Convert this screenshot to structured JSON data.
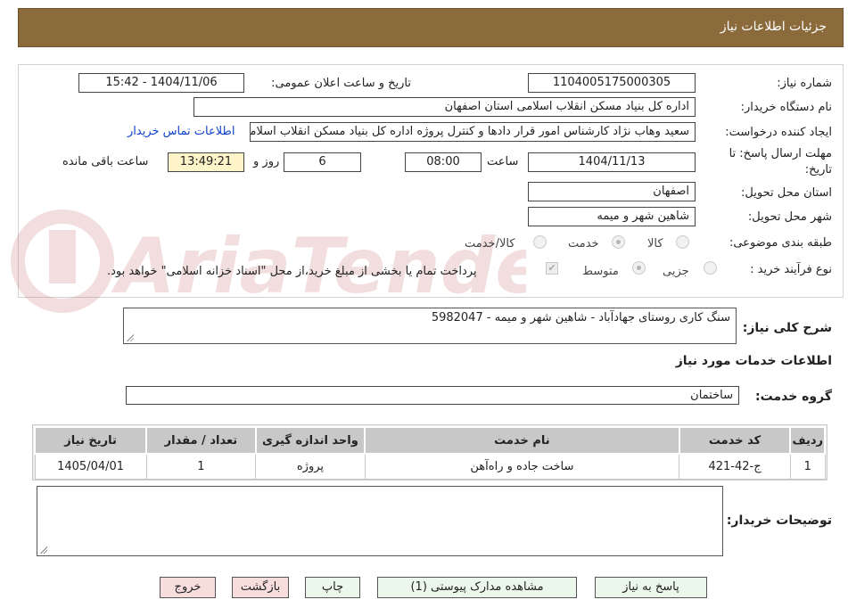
{
  "header": {
    "title": "جزئیات اطلاعات نیاز"
  },
  "form": {
    "need_number_label": "شماره نیاز:",
    "need_number": "1104005175000305",
    "announce_label": "تاریخ و ساعت اعلان عمومی:",
    "announce_value": "1404/11/06 - 15:42",
    "buyer_org_label": "نام دستگاه خریدار:",
    "buyer_org": "اداره کل بنیاد مسکن انقلاب اسلامی استان اصفهان",
    "creator_label": "ایجاد کننده درخواست:",
    "creator": "سعید وهاب نژاد کارشناس امور قرار دادها و کنترل  پروژه اداره کل بنیاد مسکن انقلاب اسلامی استان اصفهان",
    "contact_link": "اطلاعات تماس خریدار",
    "deadline_label_1": "مهلت ارسال پاسخ: تا",
    "deadline_label_2": "تاریخ:",
    "deadline_date": "1404/11/13",
    "time_label": "ساعت",
    "deadline_time": "08:00",
    "days_value": "6",
    "days_label": "روز و",
    "remaining_time": "13:49:21",
    "remaining_label": "ساعت باقی مانده",
    "province_label": "استان محل تحویل:",
    "province": "اصفهان",
    "city_label": "شهر محل تحویل:",
    "city": "شاهین شهر و میمه",
    "category_label": "طبقه بندی موضوعی:",
    "category_options": [
      "کالا",
      "خدمت",
      "کالا/خدمت"
    ],
    "category_selected": "خدمت",
    "process_label": "نوع فرآیند خرید :",
    "process_options": [
      "جزیی",
      "متوسط"
    ],
    "process_selected": "متوسط",
    "treasury_note": "پرداخت تمام یا بخشی از مبلغ خرید،از محل \"اسناد خزانه اسلامی\" خواهد بود."
  },
  "description": {
    "label": "شرح کلی نیاز:",
    "value": "سنگ کاری روستای جهادآباد - شاهین شهر و میمه - 5982047"
  },
  "services": {
    "section_title": "اطلاعات خدمات مورد نیاز",
    "group_label": "گروه خدمت:",
    "group_value": "ساختمان",
    "table_headers": [
      "ردیف",
      "کد خدمت",
      "نام خدمت",
      "واحد اندازه گیری",
      "تعداد / مقدار",
      "تاریخ نیاز"
    ],
    "rows": [
      {
        "row": "1",
        "code": "ج-42-421",
        "name": "ساخت جاده و راه‌آهن",
        "unit": "پروژه",
        "qty": "1",
        "date": "1405/04/01"
      }
    ]
  },
  "buyer_notes": {
    "label": "توضیحات خریدار:",
    "value": ""
  },
  "buttons": {
    "reply": "پاسخ به نیاز",
    "attachments": "مشاهده مدارک پیوستی (1)",
    "print": "چاپ",
    "back": "بازگشت",
    "exit": "خروج"
  },
  "watermark": {
    "text": "AriaTender.neT"
  },
  "colors": {
    "header_bg": "#8b6a3b",
    "link": "#1144cc",
    "highlight": "#fdf5c9",
    "table_header": "#c8c8c8"
  }
}
